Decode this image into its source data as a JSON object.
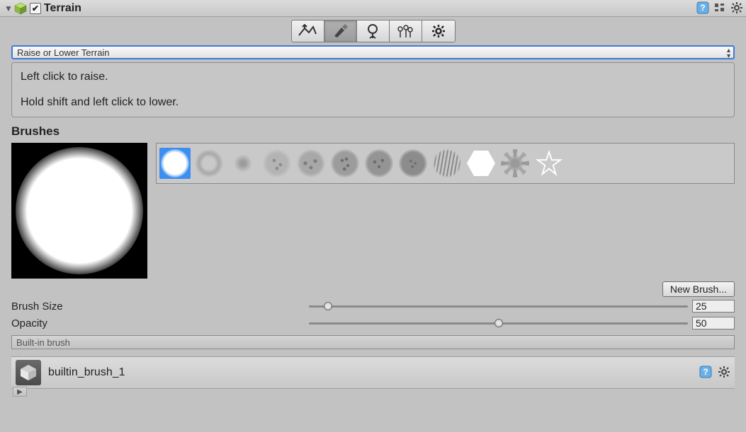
{
  "header": {
    "title": "Terrain",
    "enabled_checked": "✔"
  },
  "toolbar": {
    "selected_index": 1,
    "items": [
      {
        "name": "raise-lower-tool",
        "tooltip": "Raise / Lower Terrain"
      },
      {
        "name": "paint-tool",
        "tooltip": "Paint Terrain"
      },
      {
        "name": "tree-tool",
        "tooltip": "Paint Trees"
      },
      {
        "name": "detail-tool",
        "tooltip": "Paint Details"
      },
      {
        "name": "settings-tool",
        "tooltip": "Terrain Settings"
      }
    ]
  },
  "mode_select": {
    "selected": "Raise or Lower Terrain"
  },
  "help": {
    "line1": "Left click to raise.",
    "line2": "Hold shift and left click to lower."
  },
  "brushes": {
    "section_title": "Brushes",
    "selected_index": 0,
    "items": [
      {
        "name": "brush-soft-round"
      },
      {
        "name": "brush-soft-ring"
      },
      {
        "name": "brush-small-dot"
      },
      {
        "name": "brush-noise-1"
      },
      {
        "name": "brush-noise-2"
      },
      {
        "name": "brush-noise-3"
      },
      {
        "name": "brush-noise-4"
      },
      {
        "name": "brush-noise-5"
      },
      {
        "name": "brush-stripes"
      },
      {
        "name": "brush-hexagon"
      },
      {
        "name": "brush-sparkle"
      },
      {
        "name": "brush-star-outline"
      }
    ]
  },
  "buttons": {
    "new_brush": "New Brush..."
  },
  "props": {
    "brush_size": {
      "label": "Brush Size",
      "value": "25",
      "min": 1,
      "max": 500,
      "pos_pct": 5
    },
    "opacity": {
      "label": "Opacity",
      "value": "50",
      "min": 0,
      "max": 100,
      "pos_pct": 50
    }
  },
  "status": {
    "text": "Built-in brush"
  },
  "asset": {
    "name": "builtin_brush_1"
  }
}
